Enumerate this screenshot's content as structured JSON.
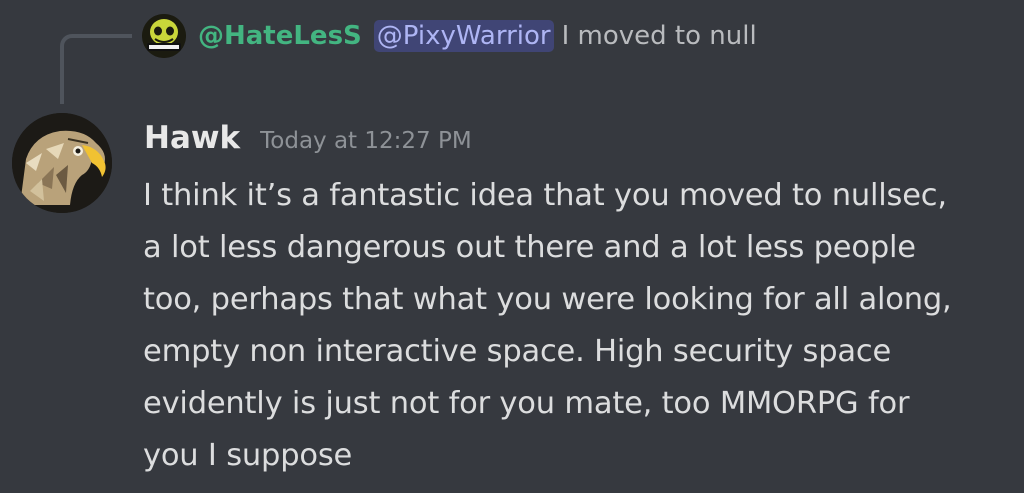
{
  "reply": {
    "avatar_icon": "hateless-skull-avatar",
    "avatar_logo_text": "HATELESS",
    "author": "@HateLesS",
    "author_color": "#43b581",
    "mention": "@PixyWarrior",
    "mention_color": "#aeb5f4",
    "text": "I moved to null"
  },
  "message": {
    "avatar_icon": "eagle-avatar",
    "author": "Hawk",
    "timestamp": "Today at 12:27 PM",
    "lines": [
      "I think it’s a fantastic idea that you moved to nullsec,",
      "a lot less dangerous out there and a lot less people",
      "too, perhaps that what you were looking for all along,",
      "empty non interactive space. High security space",
      "evidently is just not for you mate, too MMORPG for",
      "you I suppose"
    ]
  },
  "theme": {
    "background": "#36393f",
    "text": "#dcddde",
    "muted": "#8e9297"
  }
}
